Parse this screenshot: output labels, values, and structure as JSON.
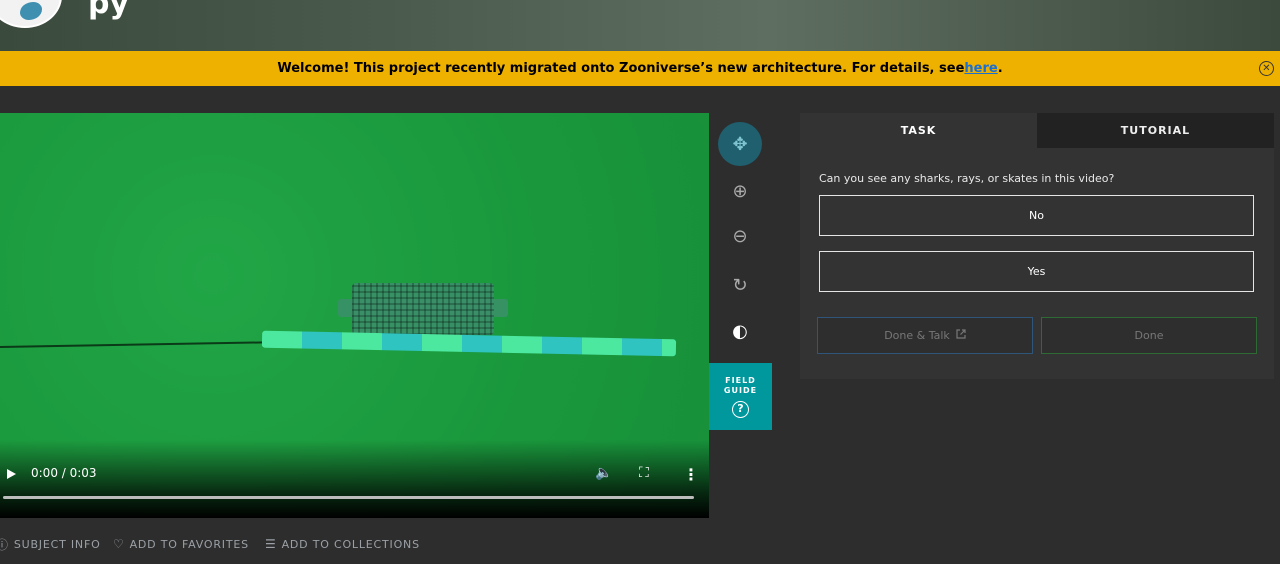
{
  "header": {
    "title_fragment": "py"
  },
  "banner": {
    "text": "Welcome! This project recently migrated onto Zooniverse’s new architecture. For details, see ",
    "link": "here",
    "suffix": ".",
    "close_icon": "✕"
  },
  "video": {
    "time": "0:00 / 0:03",
    "progress": 0
  },
  "toolbar": {
    "tools": [
      {
        "name": "move",
        "icon": "✥"
      },
      {
        "name": "zoom-in",
        "icon": "⊕"
      },
      {
        "name": "zoom-out",
        "icon": "⊖"
      },
      {
        "name": "reset",
        "icon": "↻"
      },
      {
        "name": "invert",
        "icon": "◐"
      }
    ],
    "field_guide": {
      "line1": "FIELD",
      "line2": "GUIDE",
      "icon": "?"
    }
  },
  "task": {
    "tabs": [
      {
        "label": "TASK"
      },
      {
        "label": "TUTORIAL"
      }
    ],
    "question": "Can you see any sharks, rays, or skates in this video?",
    "answers": [
      "No",
      "Yes"
    ],
    "done_talk": "Done & Talk",
    "done": "Done"
  },
  "meta_bar": {
    "subject_info": "SUBJECT INFO",
    "favorites": "ADD TO FAVORITES",
    "collections": "ADD TO COLLECTIONS"
  },
  "colors": {
    "banner": "#efb100",
    "field_guide": "#00979d",
    "background": "#2d2d2d"
  }
}
